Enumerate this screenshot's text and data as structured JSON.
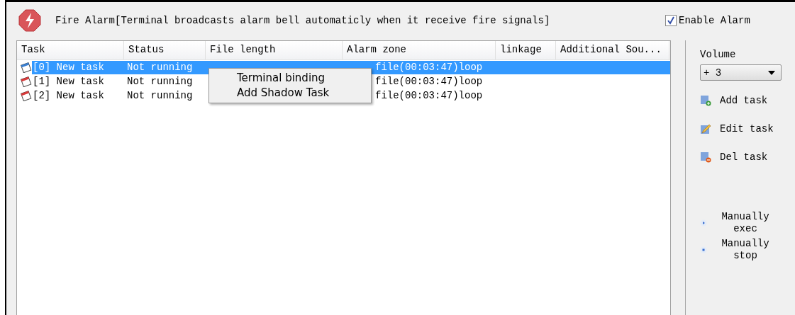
{
  "header": {
    "title": "Fire Alarm[Terminal broadcasts alarm bell automaticly when it receive fire signals]",
    "enable_alarm": {
      "label": "Enable Alarm",
      "checked": true
    }
  },
  "table": {
    "columns": [
      "Task",
      "Status",
      "File length",
      "Alarm zone",
      "linkage",
      "Additional Sou..."
    ],
    "rows": [
      {
        "task": "[0] New task",
        "status": "Not running",
        "alarm_zone": "file(00:03:47)loop",
        "selected": true
      },
      {
        "task": "[1] New task",
        "status": "Not running",
        "alarm_zone": "file(00:03:47)loop",
        "selected": false
      },
      {
        "task": "[2] New task",
        "status": "Not running",
        "alarm_zone": "file(00:03:47)loop",
        "selected": false
      }
    ]
  },
  "context_menu": [
    "Terminal binding",
    "Add Shadow Task"
  ],
  "volume": {
    "label": "Volume",
    "value": "+ 3"
  },
  "actions": [
    {
      "label": "Add task",
      "kind": "add"
    },
    {
      "label": "Edit task",
      "kind": "edit"
    },
    {
      "label": "Del task",
      "kind": "del"
    }
  ],
  "manual": [
    {
      "label": "Manually exec",
      "kind": "exec"
    },
    {
      "label": "Manually stop",
      "kind": "stop"
    }
  ]
}
